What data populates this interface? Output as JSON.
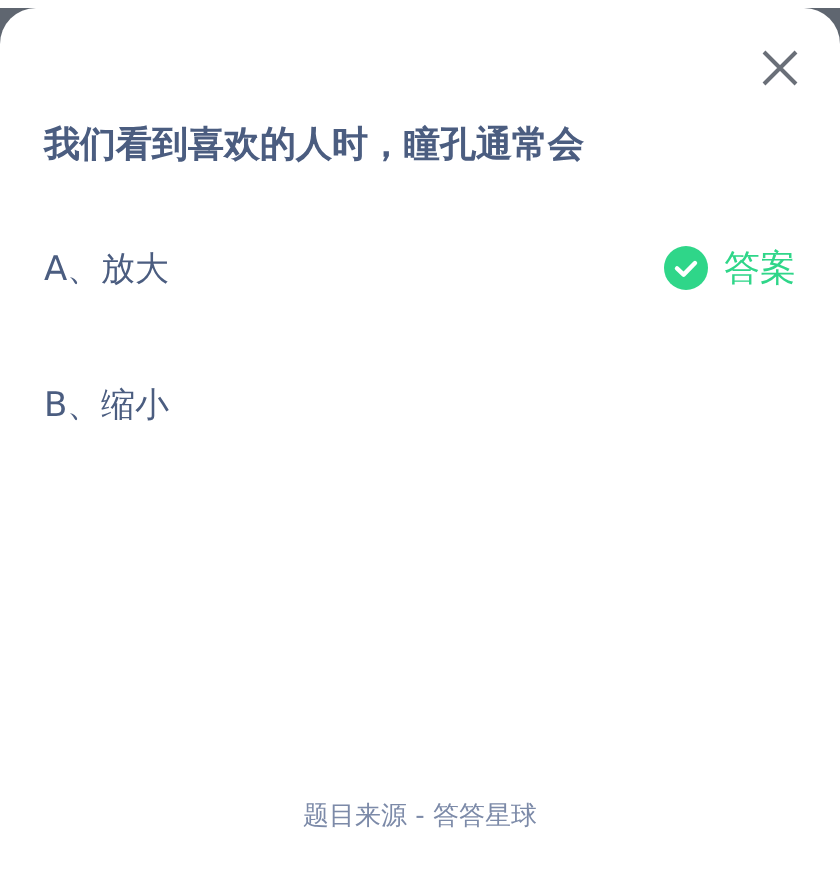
{
  "question": "我们看到喜欢的人时，瞳孔通常会",
  "options": [
    {
      "label": "A、放大",
      "correct": true,
      "answer_label": "答案"
    },
    {
      "label": "B、缩小",
      "correct": false
    }
  ],
  "footer": "题目来源 - 答答星球"
}
